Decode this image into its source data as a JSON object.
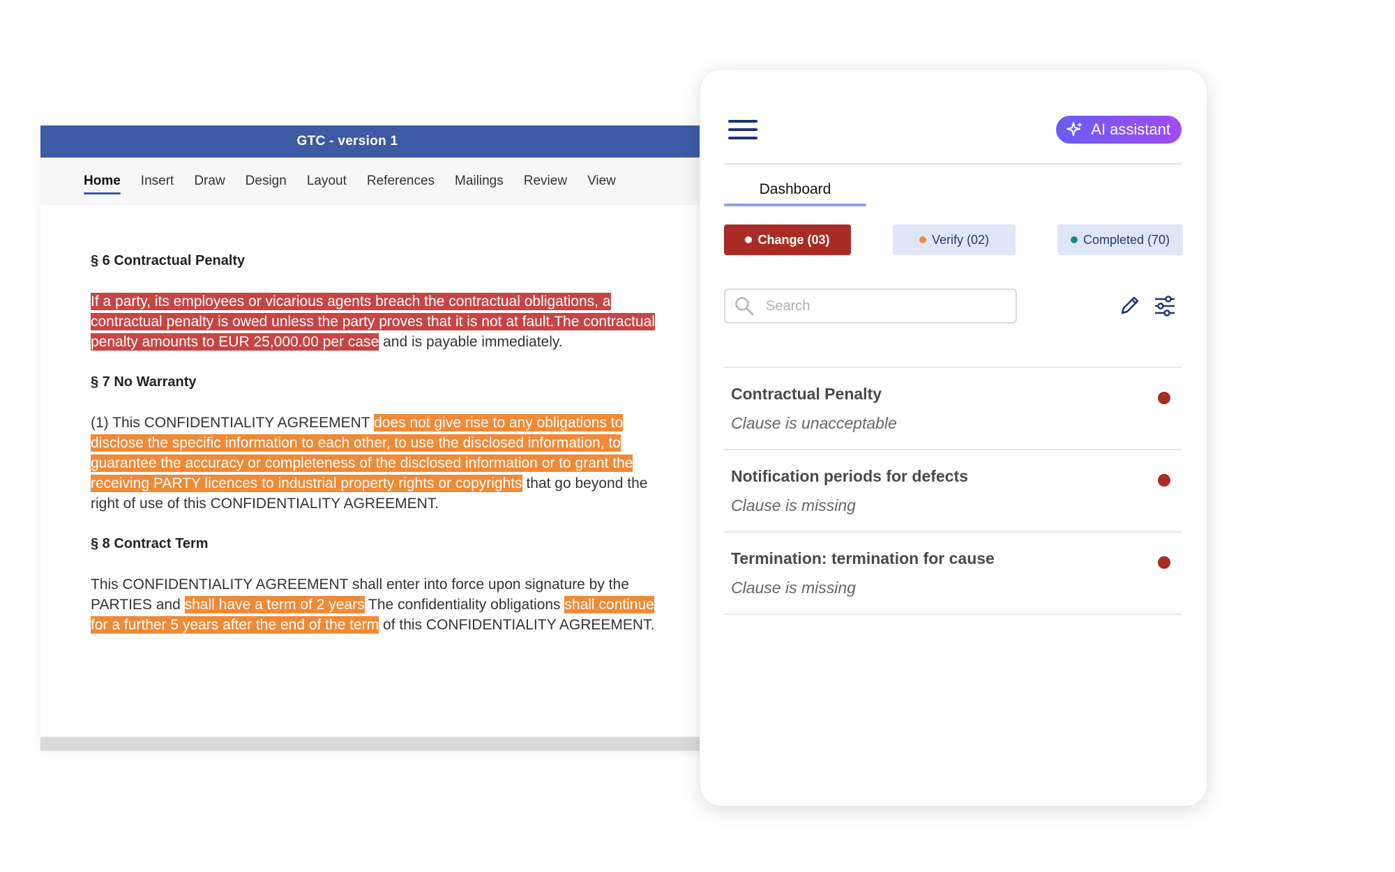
{
  "document": {
    "title": "GTC - version 1",
    "ribbon_tabs": [
      "Home",
      "Insert",
      "Draw",
      "Design",
      "Layout",
      "References",
      "Mailings",
      "Review",
      "View"
    ],
    "active_tab": "Home",
    "sections": [
      {
        "title": "§ 6 Contractual Penalty",
        "red": "If a party, its employees or vicarious agents breach the contractual obligations, a contractual penalty is owed unless the party proves that it is not at fault.The contractual penalty amounts to EUR 25,000.00 per case",
        "rest": " and is payable immediately."
      },
      {
        "title": "§ 7 No Warranty",
        "pre": "(1) This CONFIDENTIALITY AGREEMENT ",
        "orange": "does not give rise to any obligations to disclose the specific information to each other, to use the disclosed information, to guarantee the accuracy or completeness of the disclosed information or to grant the receiving PARTY licences to industrial property rights or copyrights",
        "rest": " that go beyond the right of use of this CONFIDENTIALITY AGREEMENT."
      },
      {
        "title": "§ 8 Contract Term",
        "pre": "This CONFIDENTIALITY AGREEMENT shall enter into force upon signature by the PARTIES and ",
        "orange1": "shall have a term of 2 years",
        "mid": " The confidentiality obligations ",
        "orange2": "shall continue for a further 5 years after the end of the term",
        "rest": " of this CONFIDENTIALITY AGREEMENT."
      }
    ]
  },
  "panel": {
    "ai_label": "AI assistant",
    "tab": "Dashboard",
    "filters": {
      "change": "Change (03)",
      "verify": "Verify (02)",
      "completed": "Completed (70)"
    },
    "search_placeholder": "Search",
    "items": [
      {
        "title": "Contractual Penalty",
        "status": "Clause is unacceptable"
      },
      {
        "title": "Notification periods for defects",
        "status": "Clause is missing"
      },
      {
        "title": "Termination: termination for cause",
        "status": "Clause is missing"
      }
    ],
    "colors": {
      "accent": "#3d5aa5",
      "change": "#a82c25",
      "verify": "#ef8a36",
      "completed": "#1c8a8a",
      "highlight_red": "#c64545",
      "highlight_orange": "#ef8a36"
    }
  }
}
